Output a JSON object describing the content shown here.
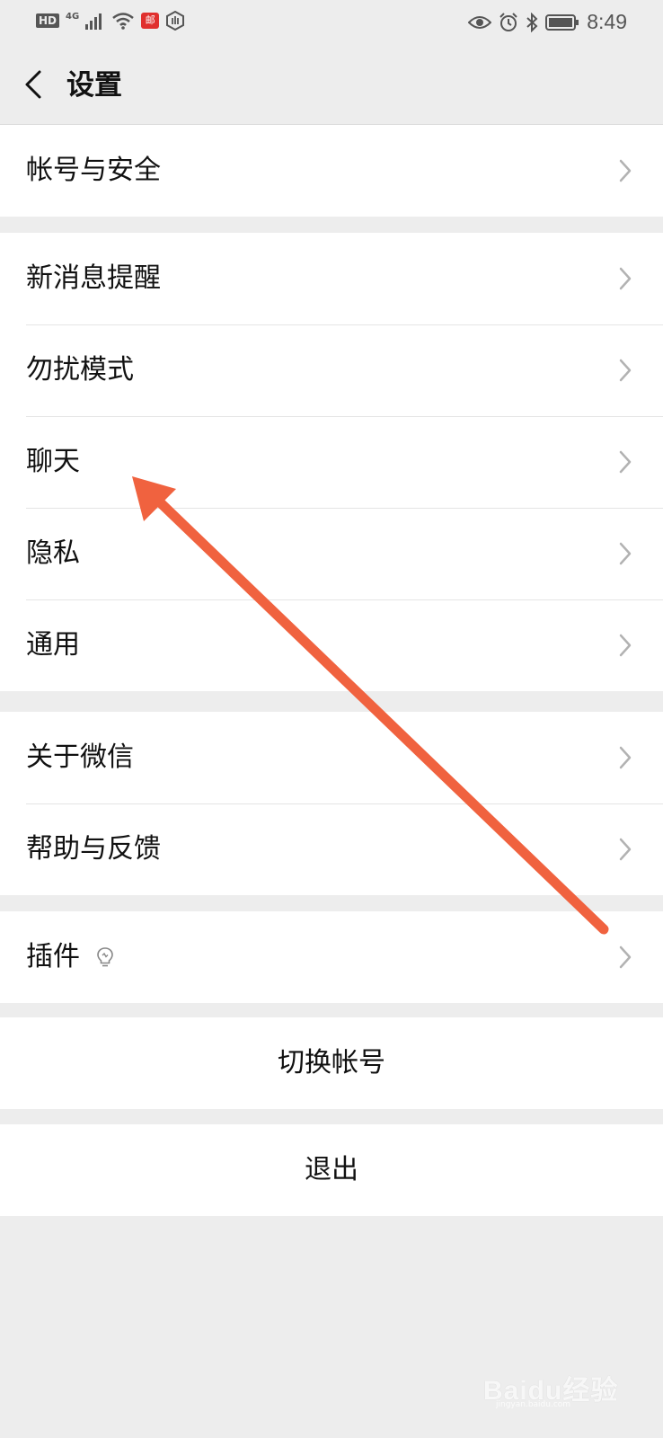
{
  "status_bar": {
    "hd": "HD",
    "network": "4G",
    "mail_badge": "邮",
    "time": "8:49"
  },
  "header": {
    "title": "设置"
  },
  "groups": [
    {
      "items": [
        {
          "label": "帐号与安全"
        }
      ]
    },
    {
      "items": [
        {
          "label": "新消息提醒"
        },
        {
          "label": "勿扰模式"
        },
        {
          "label": "聊天"
        },
        {
          "label": "隐私"
        },
        {
          "label": "通用"
        }
      ]
    },
    {
      "items": [
        {
          "label": "关于微信"
        },
        {
          "label": "帮助与反馈"
        }
      ]
    },
    {
      "items": [
        {
          "label": "插件"
        }
      ]
    }
  ],
  "actions": {
    "switch_account": "切换帐号",
    "logout": "退出"
  },
  "annotation": {
    "color": "#f0623f"
  },
  "watermark": {
    "brand": "Baidu经验",
    "url": "jingyan.baidu.com"
  }
}
